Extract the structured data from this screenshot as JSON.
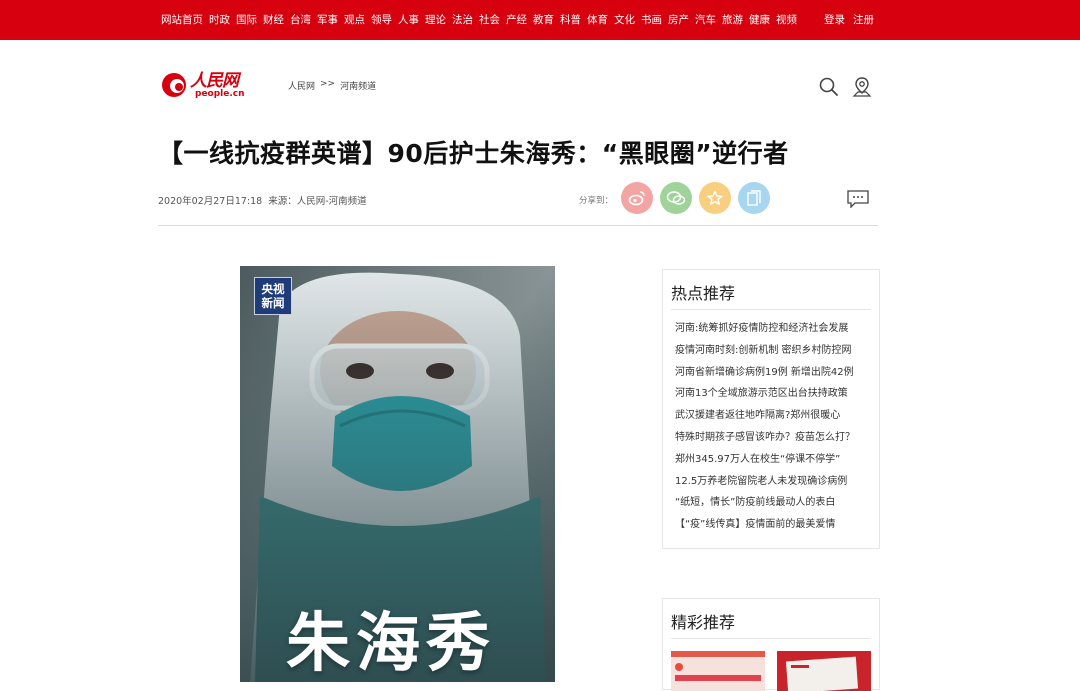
{
  "top_nav": {
    "items": [
      "网站首页",
      "时政",
      "国际",
      "财经",
      "台湾",
      "军事",
      "观点",
      "领导",
      "人事",
      "理论",
      "法治",
      "社会",
      "产经",
      "教育",
      "科普",
      "体育",
      "文化",
      "书画",
      "房产",
      "汽车",
      "旅游",
      "健康",
      "视频"
    ],
    "login": "登录",
    "register": "注册"
  },
  "header": {
    "logo_text": "人民网",
    "logo_sub": "people.cn",
    "breadcrumb": {
      "home": "人民网",
      "sep": ">>",
      "channel": "河南频道"
    }
  },
  "article": {
    "title": "【一线抗疫群英谱】90后护士朱海秀：“黑眼圈”逆行者",
    "date": "2020年02月27日17:18",
    "source": "来源：人民网-河南频道",
    "share_label": "分享到：",
    "image": {
      "badge_line1": "央视",
      "badge_line2": "新闻",
      "overlay_name": "朱海秀"
    }
  },
  "sidebar": {
    "hot_title": "热点推荐",
    "hot_items": [
      "河南:统筹抓好疫情防控和经济社会发展",
      "疫情河南时刻:创新机制 密织乡村防控网",
      "河南省新增确诊病例19例 新增出院42例",
      "河南13个全域旅游示范区出台扶持政策",
      "武汉援建者返往地咋隔离?郑州很暖心",
      "特殊时期孩子感冒该咋办？疫苗怎么打？",
      "郑州345.97万人在校生“停课不停学”",
      "12.5万养老院留院老人未发现确诊病例",
      "“纸短，情长”防疫前线最动人的表白",
      "【“疫”线传真】疫情面前的最美爱情"
    ],
    "featured_title": "精彩推荐"
  },
  "colors": {
    "brand_red": "#d7000f",
    "weibo": "#f2a5a3",
    "wechat": "#9fd39a",
    "favorite": "#f7cf7e",
    "copy": "#a8d5ef"
  },
  "icons": [
    "search-icon",
    "location-icon",
    "weibo-icon",
    "wechat-icon",
    "star-icon",
    "copy-icon",
    "comment-icon"
  ]
}
